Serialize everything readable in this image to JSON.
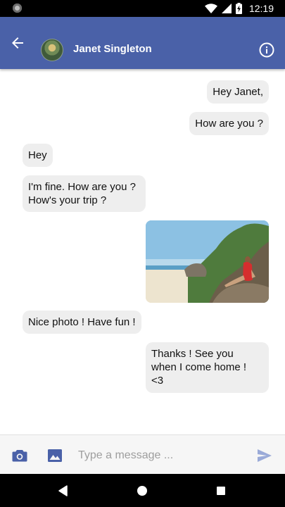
{
  "status_bar": {
    "time": "12:19",
    "icons": [
      "notification-dot-icon",
      "wifi-icon",
      "signal-icon",
      "battery-charging-icon"
    ]
  },
  "app_bar": {
    "back_icon": "arrow-back-icon",
    "contact_name": "Janet Singleton",
    "info_icon": "info-icon",
    "color": "#4a61a8"
  },
  "messages": [
    {
      "side": "sent",
      "text": "Hey Janet,"
    },
    {
      "side": "sent",
      "text": "How are you ?"
    },
    {
      "side": "received",
      "text": "Hey"
    },
    {
      "side": "received",
      "text": "I'm fine. How are you ?\nHow's your trip ?"
    },
    {
      "side": "sent",
      "type": "image",
      "alt": "beach photo"
    },
    {
      "side": "received",
      "text": "Nice photo ! Have fun !"
    },
    {
      "side": "sent",
      "text": "Thanks ! See you\nwhen I come home !\n<3"
    }
  ],
  "input_bar": {
    "camera_icon": "camera-icon",
    "image_icon": "image-icon",
    "placeholder": "Type a message ...",
    "value": "",
    "send_icon": "send-icon"
  },
  "nav_bar": {
    "icons": [
      "back-triangle-icon",
      "home-circle-icon",
      "recents-square-icon"
    ]
  },
  "colors": {
    "bubble": "#eeeeee",
    "accent": "#4a61a8",
    "send_inactive": "#9aaad8"
  }
}
